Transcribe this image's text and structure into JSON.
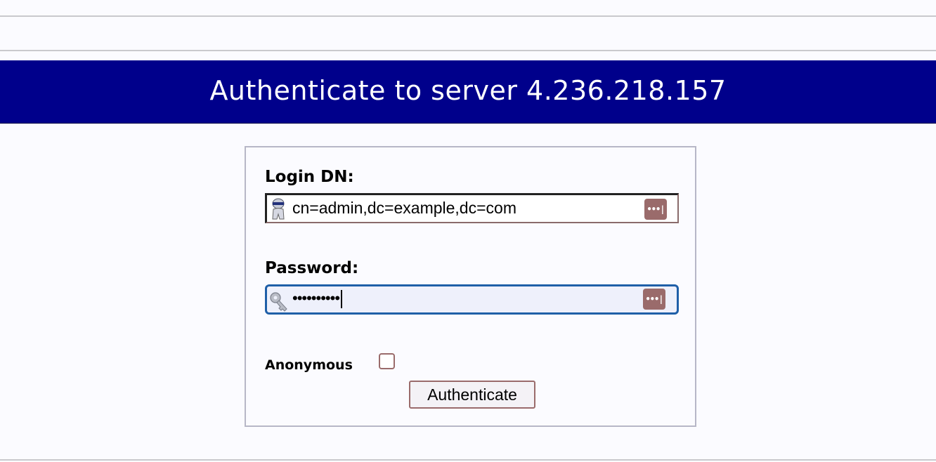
{
  "header": {
    "title": "Authenticate to server 4.236.218.157"
  },
  "login_form": {
    "dn_label": "Login DN:",
    "dn_value": "cn=admin,dc=example,dc=com",
    "password_label": "Password:",
    "password_masked": "••••••••••",
    "anonymous_label": "Anonymous",
    "anonymous_checked": false,
    "submit_label": "Authenticate",
    "password_manager_glyph": "•••|",
    "dn_icon": "user-icon",
    "password_icon": "key-icon"
  },
  "colors": {
    "header_bg": "#00008b",
    "header_text": "#ffffff",
    "page_bg": "#fbfbff",
    "focus_border": "#1f5fa8",
    "accent": "#9a6b6b"
  }
}
